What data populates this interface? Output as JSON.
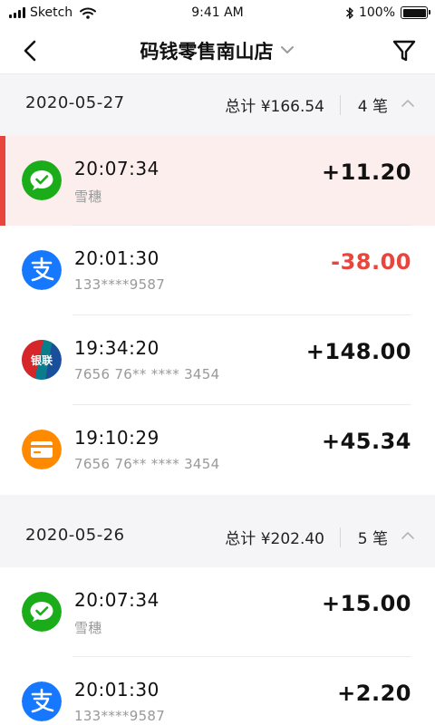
{
  "status_bar": {
    "carrier": "Sketch",
    "time": "9:41 AM",
    "battery": "100%"
  },
  "header": {
    "title": "码钱零售南山店"
  },
  "sections": [
    {
      "date": "2020-05-27",
      "total": "总计 ¥166.54",
      "count": "4 笔",
      "transactions": [
        {
          "method": "wechat",
          "icon": "wechat-pay-icon",
          "time": "20:07:34",
          "sub": "雪穗",
          "amount": "+11.20",
          "highlighted": true
        },
        {
          "method": "alipay",
          "icon": "alipay-icon",
          "time": "20:01:30",
          "sub": "133****9587",
          "amount": "-38.00",
          "negative": true
        },
        {
          "method": "unionpay",
          "icon": "unionpay-icon",
          "time": "19:34:20",
          "sub": "7656 76** **** 3454",
          "amount": "+148.00"
        },
        {
          "method": "card",
          "icon": "bank-card-icon",
          "time": "19:10:29",
          "sub": "7656 76** **** 3454",
          "amount": "+45.34"
        }
      ]
    },
    {
      "date": "2020-05-26",
      "total": "总计 ¥202.40",
      "count": "5 笔",
      "transactions": [
        {
          "method": "wechat",
          "icon": "wechat-pay-icon",
          "time": "20:07:34",
          "sub": "雪穗",
          "amount": "+15.00"
        },
        {
          "method": "alipay",
          "icon": "alipay-icon",
          "time": "20:01:30",
          "sub": "133****9587",
          "amount": "+2.20"
        }
      ]
    }
  ],
  "colors": {
    "wechat": "#1aad19",
    "alipay": "#1677ff",
    "unionpay_red": "#d7262a",
    "unionpay_blue": "#1a4f9c",
    "card": "#ff8a00",
    "negative": "#e8453c",
    "highlight_bg": "#fdeeee"
  }
}
